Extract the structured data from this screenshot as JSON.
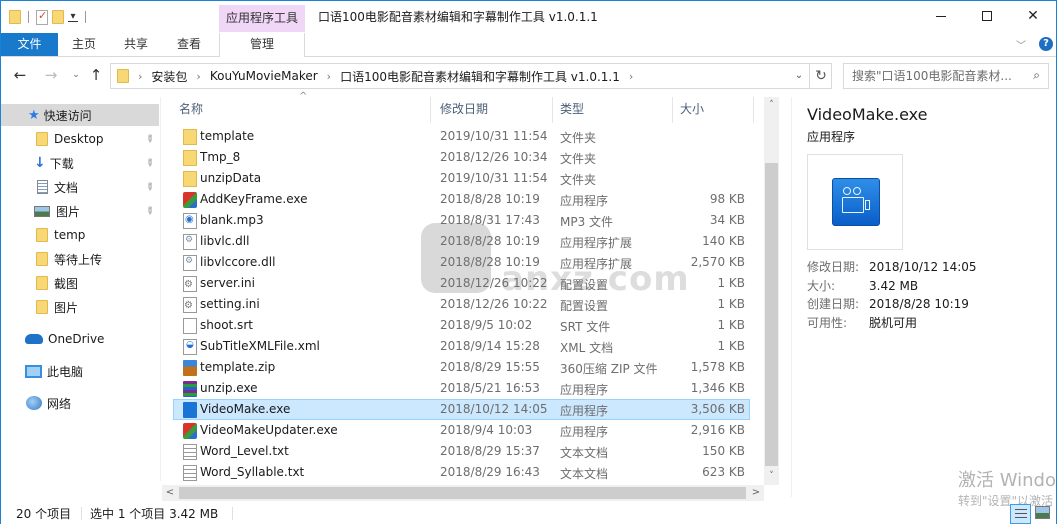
{
  "window": {
    "title": "口语100电影配音素材编辑和字幕制作工具 v1.0.1.1",
    "context_tab_group": "应用程序工具",
    "controls": {
      "minimize": "minimize",
      "maximize": "maximize",
      "close": "✕"
    }
  },
  "ribbon": {
    "tabs": [
      {
        "label": "文件"
      },
      {
        "label": "主页"
      },
      {
        "label": "共享"
      },
      {
        "label": "查看"
      },
      {
        "label": "管理"
      }
    ],
    "expand_glyph": "﹀",
    "help_glyph": "?"
  },
  "nav": {
    "back": "←",
    "forward": "→",
    "recent": "⌄",
    "up": "↑",
    "breadcrumb": [
      "安装包",
      "KouYuMovieMaker",
      "口语100电影配音素材编辑和字幕制作工具 v1.0.1.1"
    ],
    "crumb_sep": "›",
    "dropdown": "⌄",
    "refresh": "↻",
    "search_placeholder": "搜索\"口语100电影配音素材...",
    "search_glyph": "⚲"
  },
  "sidebar": {
    "quick_access": "快速访问",
    "items": [
      {
        "label": "Desktop",
        "icon": "folder-icon",
        "pinned": true
      },
      {
        "label": "下载",
        "icon": "download-icon",
        "pinned": true
      },
      {
        "label": "文档",
        "icon": "documents-icon",
        "pinned": true
      },
      {
        "label": "图片",
        "icon": "pictures-icon",
        "pinned": true
      },
      {
        "label": "temp",
        "icon": "folder-icon",
        "pinned": false
      },
      {
        "label": "等待上传",
        "icon": "folder-icon",
        "pinned": false
      },
      {
        "label": "截图",
        "icon": "folder-icon",
        "pinned": false
      },
      {
        "label": "图片",
        "icon": "folder-icon",
        "pinned": false
      }
    ],
    "onedrive": "OneDrive",
    "this_pc": "此电脑",
    "network": "网络",
    "pin_glyph": "📌"
  },
  "filelist": {
    "columns": {
      "name": "名称",
      "date": "修改日期",
      "type": "类型",
      "size": "大小"
    },
    "sort_glyph": "^",
    "files": [
      {
        "name": "template",
        "date": "2019/10/31 11:54",
        "type": "文件夹",
        "size": "",
        "icon": "folder"
      },
      {
        "name": "Tmp_8",
        "date": "2018/12/26 10:34",
        "type": "文件夹",
        "size": "",
        "icon": "folder"
      },
      {
        "name": "unzipData",
        "date": "2019/10/31 11:54",
        "type": "文件夹",
        "size": "",
        "icon": "folder"
      },
      {
        "name": "AddKeyFrame.exe",
        "date": "2018/8/28 10:19",
        "type": "应用程序",
        "size": "98 KB",
        "icon": "exe"
      },
      {
        "name": "blank.mp3",
        "date": "2018/8/31 17:43",
        "type": "MP3 文件",
        "size": "34 KB",
        "icon": "mp3"
      },
      {
        "name": "libvlc.dll",
        "date": "2018/8/28 10:19",
        "type": "应用程序扩展",
        "size": "140 KB",
        "icon": "dll"
      },
      {
        "name": "libvlccore.dll",
        "date": "2018/8/28 10:19",
        "type": "应用程序扩展",
        "size": "2,570 KB",
        "icon": "dll"
      },
      {
        "name": "server.ini",
        "date": "2018/12/26 10:22",
        "type": "配置设置",
        "size": "1 KB",
        "icon": "ini"
      },
      {
        "name": "setting.ini",
        "date": "2018/12/26 10:22",
        "type": "配置设置",
        "size": "1 KB",
        "icon": "ini"
      },
      {
        "name": "shoot.srt",
        "date": "2018/9/5 10:02",
        "type": "SRT 文件",
        "size": "1 KB",
        "icon": "blank"
      },
      {
        "name": "SubTitleXMLFile.xml",
        "date": "2018/9/14 15:28",
        "type": "XML 文档",
        "size": "1 KB",
        "icon": "xml"
      },
      {
        "name": "template.zip",
        "date": "2018/8/29 15:55",
        "type": "360压缩 ZIP 文件",
        "size": "1,578 KB",
        "icon": "zip"
      },
      {
        "name": "unzip.exe",
        "date": "2018/5/21 16:53",
        "type": "应用程序",
        "size": "1,346 KB",
        "icon": "rar"
      },
      {
        "name": "VideoMake.exe",
        "date": "2018/10/12 14:05",
        "type": "应用程序",
        "size": "3,506 KB",
        "icon": "video",
        "selected": true
      },
      {
        "name": "VideoMakeUpdater.exe",
        "date": "2018/9/4 10:03",
        "type": "应用程序",
        "size": "2,916 KB",
        "icon": "exe"
      },
      {
        "name": "Word_Level.txt",
        "date": "2018/8/29 15:37",
        "type": "文本文档",
        "size": "150 KB",
        "icon": "txt"
      },
      {
        "name": "Word_Syllable.txt",
        "date": "2018/8/29 16:43",
        "type": "文本文档",
        "size": "623 KB",
        "icon": "txt"
      }
    ]
  },
  "scroll": {
    "up": "˄",
    "down": "˅",
    "left": "<",
    "right": ">"
  },
  "details": {
    "name": "VideoMake.exe",
    "type": "应用程序",
    "props": [
      {
        "key": "修改日期:",
        "value": "2018/10/12 14:05"
      },
      {
        "key": "大小:",
        "value": "3.42 MB"
      },
      {
        "key": "创建日期:",
        "value": "2018/8/28 10:19"
      },
      {
        "key": "可用性:",
        "value": "脱机可用"
      }
    ]
  },
  "watermark": {
    "site": "anxz.com",
    "activate_title": "激活 Windows",
    "activate_sub": "转到\"设置\"以激活 Windows。"
  },
  "status": {
    "count": "20 个项目",
    "selection": "选中 1 个项目  3.42 MB"
  }
}
